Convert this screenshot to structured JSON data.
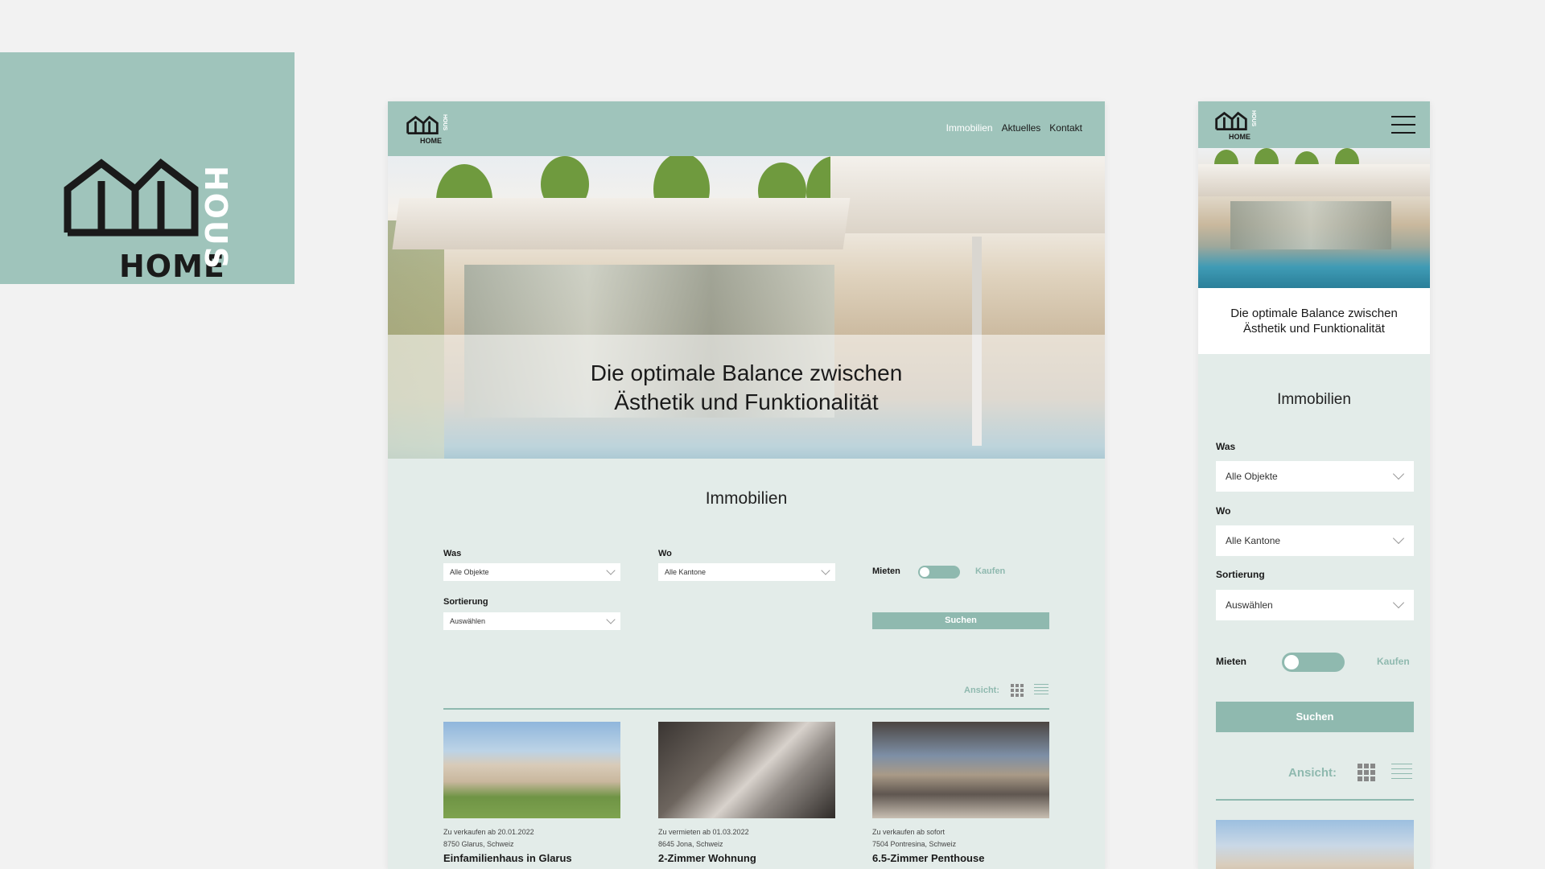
{
  "brand": {
    "word_home": "HOME",
    "word_hous": "HOUS"
  },
  "desktop": {
    "nav": {
      "items": [
        "Immobilien",
        "Aktuelles",
        "Kontakt"
      ],
      "active": "Immobilien"
    },
    "hero_title_line1": "Die optimale Balance zwischen",
    "hero_title_line2": "Ästhetik und Funktionalität",
    "section_title": "Immobilien",
    "filters": {
      "was_label": "Was",
      "was_value": "Alle Objekte",
      "wo_label": "Wo",
      "wo_value": "Alle Kantone",
      "sort_label": "Sortierung",
      "sort_value": "Auswählen",
      "toggle_left": "Mieten",
      "toggle_right": "Kaufen",
      "search_button": "Suchen"
    },
    "view_label": "Ansicht:",
    "listings": [
      {
        "status": "Zu verkaufen ab 20.01.2022",
        "location": "8750 Glarus, Schweiz",
        "title": "Einfamilienhaus in Glarus"
      },
      {
        "status": "Zu vermieten ab 01.03.2022",
        "location": "8645 Jona, Schweiz",
        "title": "2-Zimmer Wohnung"
      },
      {
        "status": "Zu verkaufen ab sofort",
        "location": "7504 Pontresina, Schweiz",
        "title": "6.5-Zimmer Penthouse"
      }
    ]
  },
  "mobile": {
    "hero_title_line1": "Die optimale Balance zwischen",
    "hero_title_line2": "Ästhetik und Funktionalität",
    "section_title": "Immobilien",
    "was_label": "Was",
    "was_value": "Alle Objekte",
    "wo_label": "Wo",
    "wo_value": "Alle Kantone",
    "sort_label": "Sortierung",
    "sort_value": "Auswählen",
    "toggle_left": "Mieten",
    "toggle_right": "Kaufen",
    "search_button": "Suchen",
    "view_label": "Ansicht:"
  },
  "colors": {
    "brand_green": "#9fc4bb",
    "accent_green": "#8fb9af",
    "panel_bg": "#e3ece9",
    "page_bg": "#f2f2f2"
  },
  "icons": [
    "house-logo-icon",
    "hamburger-icon",
    "grid-view-icon",
    "list-view-icon",
    "chevron-down-icon"
  ]
}
